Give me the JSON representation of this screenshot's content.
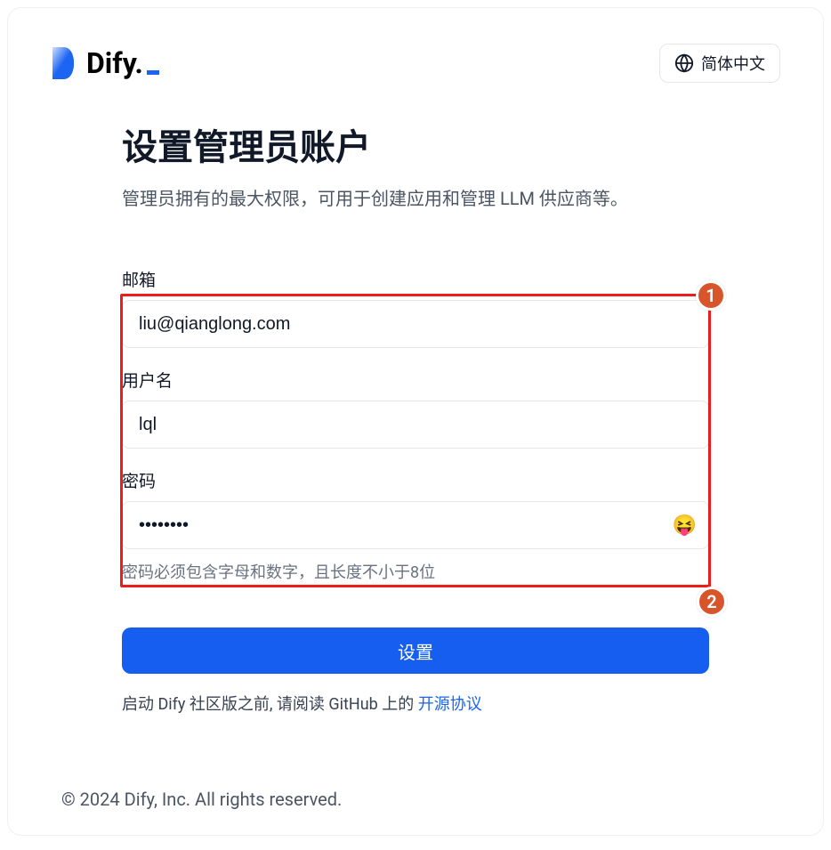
{
  "header": {
    "brand": "Dify",
    "language_label": "简体中文"
  },
  "page": {
    "title": "设置管理员账户",
    "subtitle": "管理员拥有的最大权限，可用于创建应用和管理 LLM 供应商等。"
  },
  "form": {
    "email_label": "邮箱",
    "email_value": "liu@qianglong.com",
    "username_label": "用户名",
    "username_value": "lql",
    "password_label": "密码",
    "password_value": "••••••••",
    "password_helper": "密码必须包含字母和数字，且长度不小于8位",
    "submit_label": "设置"
  },
  "agreement": {
    "prefix": "启动 Dify 社区版之前, 请阅读 GitHub 上的 ",
    "link_text": "开源协议"
  },
  "footer": {
    "copyright": "© 2024 Dify, Inc. All rights reserved."
  },
  "annotations": {
    "badge1": "1",
    "badge2": "2"
  },
  "icons": {
    "toggle_password_emoji": "😝"
  }
}
